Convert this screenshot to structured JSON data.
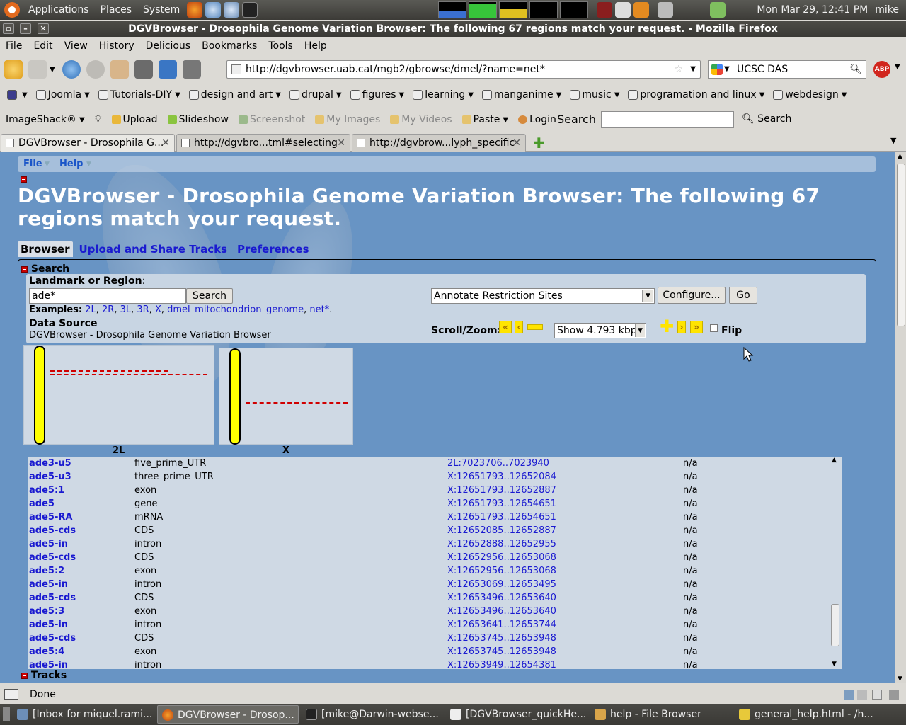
{
  "gnome_panel": {
    "menus": [
      "Applications",
      "Places",
      "System"
    ],
    "clock": "Mon Mar 29, 12:41 PM",
    "user": "mike"
  },
  "window": {
    "title": "DGVBrowser - Drosophila Genome Variation Browser: The following 67 regions match your request. - Mozilla Firefox"
  },
  "menubar": [
    "File",
    "Edit",
    "View",
    "History",
    "Delicious",
    "Bookmarks",
    "Tools",
    "Help"
  ],
  "navbar": {
    "url": "http://dgvbrowser.uab.cat/mgb2/gbrowse/dmel/?name=net*",
    "search_value": "UCSC DAS",
    "abp_label": "ABP"
  },
  "bookmarks": [
    "Joomla",
    "Tutorials-DIY",
    "design and art",
    "drupal",
    "figures",
    "learning",
    "manganime",
    "music",
    "programation and linux",
    "webdesign"
  ],
  "imageshack": {
    "brand": "ImageShack®",
    "items": [
      "Upload",
      "Slideshow",
      "Screenshot",
      "My Images",
      "My Videos",
      "Paste",
      "Login"
    ],
    "search_label": "Search",
    "search_button": "Search"
  },
  "tabs": [
    {
      "label": "DGVBrowser - Drosophila G...",
      "active": true
    },
    {
      "label": "http://dgvbro...tml#selecting",
      "active": false
    },
    {
      "label": "http://dgvbrow...lyph_specific",
      "active": false
    }
  ],
  "page": {
    "menu": [
      "File",
      "Help"
    ],
    "title": "DGVBrowser - Drosophila Genome Variation Browser: The following 67 regions match your request.",
    "subtabs": [
      "Browser",
      "Upload and Share Tracks",
      "Preferences"
    ],
    "search": {
      "section_title": "Search",
      "landmark_label": "Landmark or Region",
      "landmark_colon": ":",
      "landmark_value": "ade*",
      "search_button": "Search",
      "examples_label": "Examples",
      "examples": [
        "2L",
        "2R",
        "3L",
        "3R",
        "X",
        "dmel_mitochondrion_genome",
        "net*"
      ],
      "datasource_label": "Data Source",
      "datasource_value": "DGVBrowser - Drosophila Genome Variation Browser",
      "plugin_select": "Annotate Restriction Sites",
      "configure_button": "Configure...",
      "go_button": "Go",
      "scroll_zoom_label": "Scroll/Zoom:",
      "zoom_select": "Show 4.793 kbp",
      "flip_label": "Flip",
      "flip_checked": false
    },
    "chromosomes": [
      "2L",
      "X"
    ],
    "results": [
      {
        "name": "ade3-u5",
        "type": "five_prime_UTR",
        "position": "2L:7023706..7023940",
        "score": "n/a"
      },
      {
        "name": "ade5-u3",
        "type": "three_prime_UTR",
        "position": "X:12651793..12652084",
        "score": "n/a"
      },
      {
        "name": "ade5:1",
        "type": "exon",
        "position": "X:12651793..12652887",
        "score": "n/a"
      },
      {
        "name": "ade5",
        "type": "gene",
        "position": "X:12651793..12654651",
        "score": "n/a"
      },
      {
        "name": "ade5-RA",
        "type": "mRNA",
        "position": "X:12651793..12654651",
        "score": "n/a"
      },
      {
        "name": "ade5-cds",
        "type": "CDS",
        "position": "X:12652085..12652887",
        "score": "n/a"
      },
      {
        "name": "ade5-in",
        "type": "intron",
        "position": "X:12652888..12652955",
        "score": "n/a"
      },
      {
        "name": "ade5-cds",
        "type": "CDS",
        "position": "X:12652956..12653068",
        "score": "n/a"
      },
      {
        "name": "ade5:2",
        "type": "exon",
        "position": "X:12652956..12653068",
        "score": "n/a"
      },
      {
        "name": "ade5-in",
        "type": "intron",
        "position": "X:12653069..12653495",
        "score": "n/a"
      },
      {
        "name": "ade5-cds",
        "type": "CDS",
        "position": "X:12653496..12653640",
        "score": "n/a"
      },
      {
        "name": "ade5:3",
        "type": "exon",
        "position": "X:12653496..12653640",
        "score": "n/a"
      },
      {
        "name": "ade5-in",
        "type": "intron",
        "position": "X:12653641..12653744",
        "score": "n/a"
      },
      {
        "name": "ade5-cds",
        "type": "CDS",
        "position": "X:12653745..12653948",
        "score": "n/a"
      },
      {
        "name": "ade5:4",
        "type": "exon",
        "position": "X:12653745..12653948",
        "score": "n/a"
      },
      {
        "name": "ade5-in",
        "type": "intron",
        "position": "X:12653949..12654381",
        "score": "n/a"
      }
    ],
    "tracks_title": "Tracks"
  },
  "statusbar": {
    "text": "Done"
  },
  "taskbar": [
    {
      "label": "[Inbox for miquel.rami...",
      "active": false
    },
    {
      "label": "DGVBrowser - Drosop...",
      "active": true
    },
    {
      "label": "[mike@Darwin-webse...",
      "active": false
    },
    {
      "label": "[DGVBrowser_quickHe...",
      "active": false
    },
    {
      "label": "help - File Browser",
      "active": false
    },
    {
      "label": "general_help.html - /h...",
      "active": false
    }
  ],
  "colors": {
    "accent_link": "#1a1ad0",
    "page_bg": "#6894c4",
    "chromosome": "#ffff00",
    "hit": "#d00000"
  }
}
